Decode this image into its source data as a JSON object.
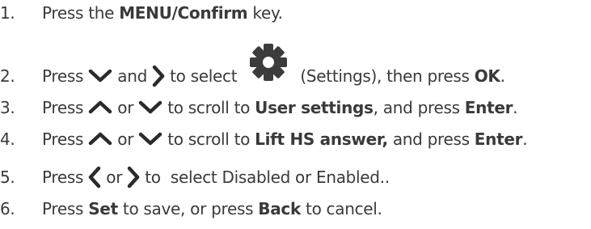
{
  "steps": [
    {
      "number": "1.",
      "parts": {
        "t1": "Press the ",
        "b1": "MENU/Confirm",
        "t2": " key."
      }
    },
    {
      "number": "2.",
      "parts": {
        "t1": "Press ",
        "t2": " and ",
        "t3": " to select ",
        "t4": " (Settings), then press ",
        "b1": "OK",
        "t5": "."
      },
      "icons": [
        "chevron-down-icon",
        "chevron-right-icon",
        "gear-icon"
      ]
    },
    {
      "number": "3.",
      "parts": {
        "t1": "Press ",
        "t2": " or ",
        "t3": " to scroll to ",
        "b1": "User settings",
        "t4": ", and press ",
        "b2": "Enter",
        "t5": "."
      },
      "icons": [
        "chevron-up-icon",
        "chevron-down-icon"
      ]
    },
    {
      "number": "4.",
      "parts": {
        "t1": "Press ",
        "t2": " or ",
        "t3": " to scroll to ",
        "b1": "Lift HS answer,",
        "t4": " and press ",
        "b2": "Enter",
        "t5": "."
      },
      "icons": [
        "chevron-up-icon",
        "chevron-down-icon"
      ]
    },
    {
      "number": "5.",
      "parts": {
        "t1": "Press ",
        "t2": " or ",
        "t3": " to  select Disabled or Enabled.."
      },
      "icons": [
        "chevron-left-icon",
        "chevron-right-icon"
      ]
    },
    {
      "number": "6.",
      "parts": {
        "t1": "Press ",
        "b1": "Set",
        "t2": " to save, or press ",
        "b2": "Back",
        "t3": " to cancel."
      }
    }
  ],
  "colors": {
    "text": "#3a3a3a",
    "icon": "#2b2b2b",
    "gear": "#3c3c3c"
  }
}
